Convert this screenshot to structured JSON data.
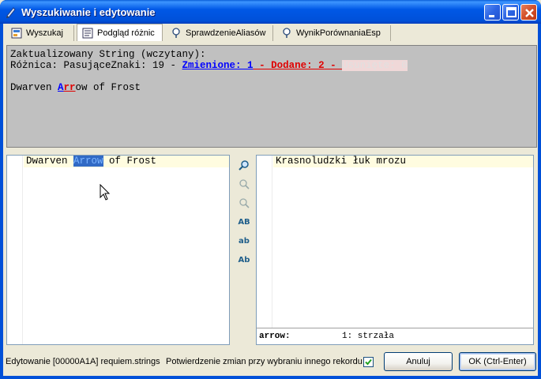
{
  "window": {
    "title": "Wyszukiwanie i edytowanie"
  },
  "tabs": [
    {
      "label": "Wyszukaj",
      "icon": "search-form-icon"
    },
    {
      "label": "Podgląd różnic",
      "icon": "compare-icon",
      "active": true
    },
    {
      "label": "SprawdzenieAliasów",
      "icon": "pin-icon"
    },
    {
      "label": "WynikPorównaniaEsp",
      "icon": "pin-icon"
    }
  ],
  "info": {
    "line1": "Zaktualizowany String (wczytany):",
    "diff_prefix": "Różnica: PasująceZnaki: 19 - ",
    "changed": "Zmienione: 1",
    "sep1": " - ",
    "added": "Dodane: 2",
    "sep2": " - ",
    "removed": "Usunięte: 0",
    "preview_before": "Dwarven ",
    "preview_changed": "A",
    "preview_added": "rr",
    "preview_after": "ow of Frost"
  },
  "left_editor": {
    "before": "Dwarven ",
    "selected": "Arrow",
    "after": " of Frost"
  },
  "right_editor": {
    "text": "Krasnoludzki łuk mrozu"
  },
  "dictionary": {
    "key": "arrow:",
    "value": "1: strzała"
  },
  "tools": [
    {
      "name": "search-icon",
      "glyph": "⌕"
    },
    {
      "name": "find-previous-icon",
      "glyph": ""
    },
    {
      "name": "find-next-icon",
      "glyph": ""
    },
    {
      "name": "uppercase-icon",
      "glyph": "AB"
    },
    {
      "name": "lowercase-icon",
      "glyph": "ab"
    },
    {
      "name": "capitalize-icon",
      "glyph": "Ab"
    }
  ],
  "footer": {
    "editing_label": "Edytowanie [00000A1A] requiem.strings",
    "confirm_label": "Potwierdzenie zmian przy wybraniu innego rekordu",
    "confirm_checked": true,
    "cancel_label": "Anuluj",
    "ok_label": "OK (Ctrl-Enter)"
  },
  "colors": {
    "titlebar": "#0058e6",
    "changed": "#0000ff",
    "added": "#e00000",
    "selection": "#316ac5"
  }
}
